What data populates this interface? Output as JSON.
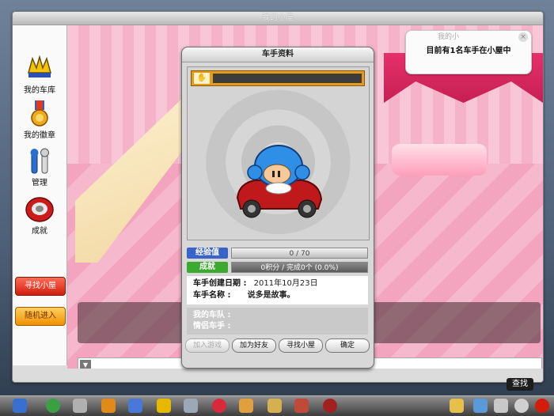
{
  "window": {
    "title": "我的小屋"
  },
  "sidebar": {
    "items": [
      {
        "label": "我的车库",
        "icon": "garage-icon"
      },
      {
        "label": "我的徽章",
        "icon": "medal-icon"
      },
      {
        "label": "管理",
        "icon": "tools-icon"
      },
      {
        "label": "成就",
        "icon": "achievement-icon"
      }
    ],
    "find_room": "寻找小屋",
    "random_enter": "随机进入"
  },
  "notice": {
    "header": "我的小",
    "text": "目前有1名车手在小屋中"
  },
  "dialog": {
    "title": "车手资料",
    "exp_label": "经验值",
    "exp_value": "0 / 70",
    "achievement_label": "成就",
    "achievement_value": "0积分 / 完成0个  (0.0%)",
    "created_label": "车手创建日期 :",
    "created_value": "2011年10月23日",
    "name_label": "车手名称 :",
    "name_value": "说多是故事。",
    "team_label": "我的车队 :",
    "partner_label": "情侣车手 :",
    "buttons": {
      "join": "加入游戏",
      "add_friend": "加为好友",
      "find_room": "寻找小屋",
      "ok": "确定"
    }
  },
  "find_label": "查找",
  "colors": {
    "accent_red": "#d21d0d",
    "accent_orange": "#f09000",
    "exp_blue": "#3a63c9",
    "ach_green": "#3caa2e"
  }
}
